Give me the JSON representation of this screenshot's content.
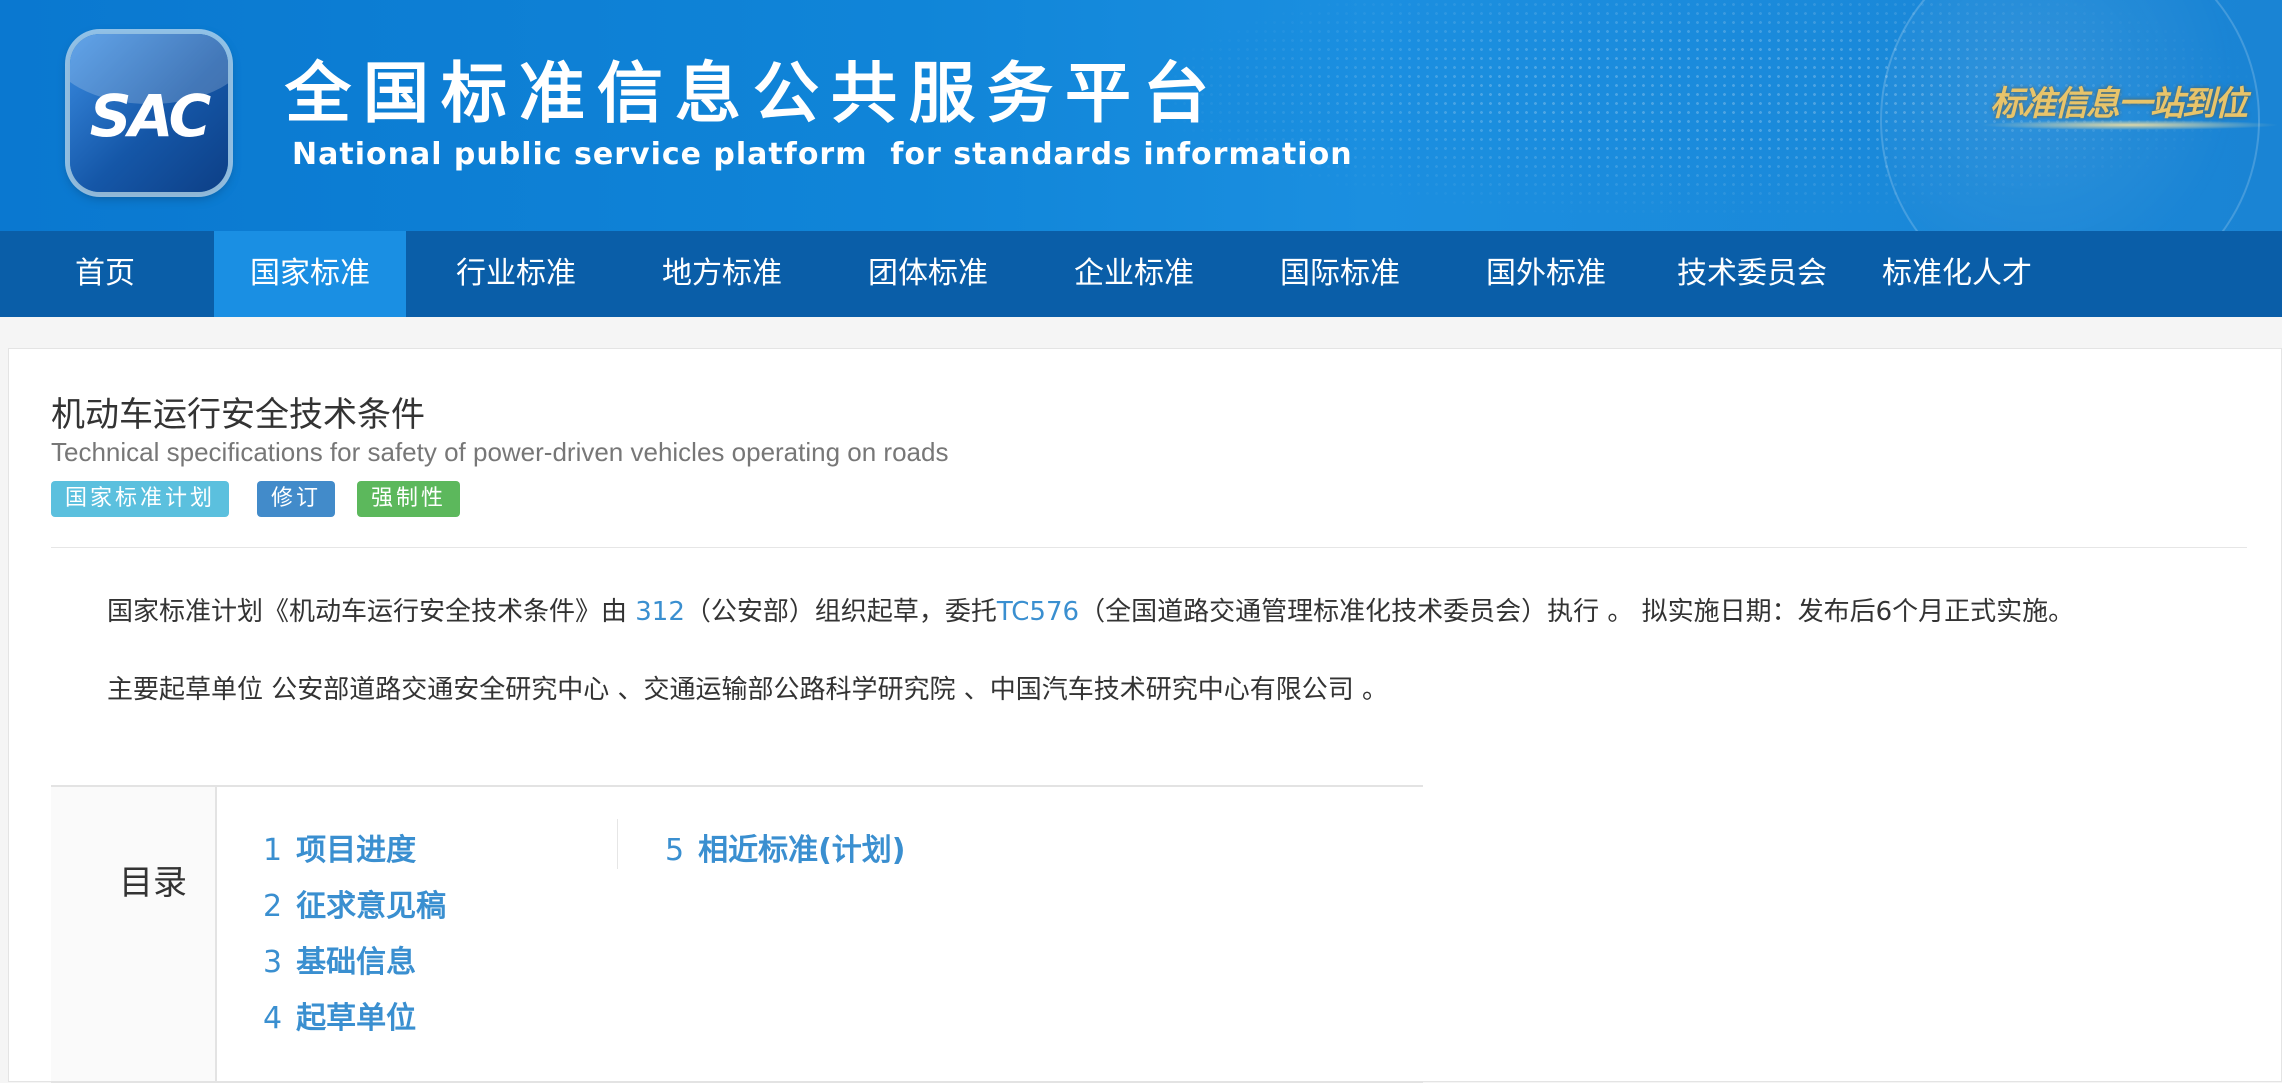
{
  "header": {
    "logo_text": "SAC",
    "title": "全国标准信息公共服务平台",
    "subtitle": "National public service platform  for standards information",
    "slogan": "标准信息一站到位"
  },
  "nav": {
    "items": [
      "首页",
      "国家标准",
      "行业标准",
      "地方标准",
      "团体标准",
      "企业标准",
      "国际标准",
      "国外标准",
      "技术委员会",
      "标准化人才"
    ],
    "active_index": 1
  },
  "standard": {
    "title_cn": "机动车运行安全技术条件",
    "title_en": "Technical specifications for safety of power-driven vehicles operating on roads",
    "tags": [
      {
        "label": "国家标准计划",
        "color": "#5bc0de"
      },
      {
        "label": "修订",
        "color": "#428bca"
      },
      {
        "label": "强制性",
        "color": "#5cb85c"
      }
    ],
    "para1": {
      "prefix": "国家标准计划《机动车运行安全技术条件》由 ",
      "org_code": "312",
      "mid": "（公安部）组织起草，委托",
      "tc_code": "TC576",
      "suffix": "（全国道路交通管理标准化技术委员会）执行 。 拟实施日期：发布后6个月正式实施。"
    },
    "para2": "主要起草单位 公安部道路交通安全研究中心 、交通运输部公路科学研究院 、中国汽车技术研究中心有限公司 。"
  },
  "toc": {
    "label": "目录",
    "items": [
      {
        "num": "1",
        "label": "项目进度"
      },
      {
        "num": "2",
        "label": "征求意见稿"
      },
      {
        "num": "3",
        "label": "基础信息"
      },
      {
        "num": "4",
        "label": "起草单位"
      },
      {
        "num": "5",
        "label": "相近标准(计划)"
      }
    ]
  }
}
